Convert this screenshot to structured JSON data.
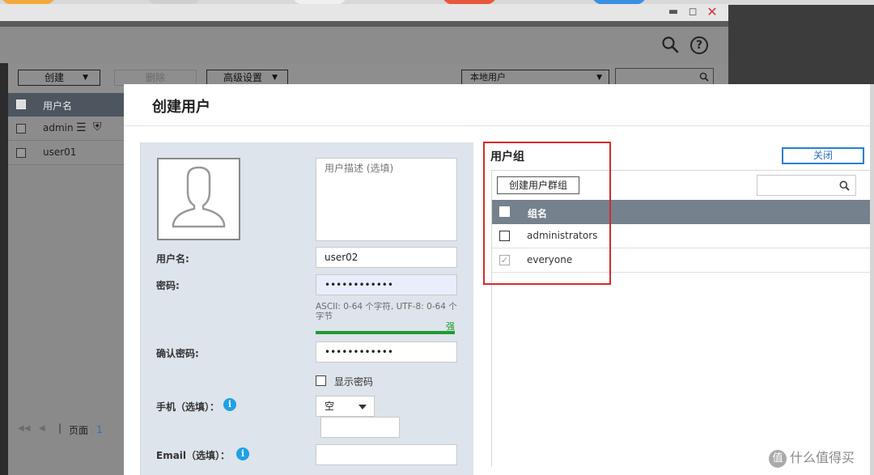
{
  "background_window": {
    "toolbar": {
      "create_label": "创建",
      "delete_label": "删除",
      "advanced_label": "高级设置",
      "scope_select": "本地用户"
    },
    "table": {
      "header": "用户名",
      "rows": [
        {
          "name": "admin"
        },
        {
          "name": "user01"
        }
      ]
    },
    "pager": {
      "page_label": "页面",
      "page_number": "1"
    }
  },
  "modal": {
    "title": "创建用户",
    "form": {
      "description_placeholder": "用户描述 (选填)",
      "username_label": "用户名:",
      "username_value": "user02",
      "password_label": "密码:",
      "password_value": "••••••••••••",
      "password_hint": "ASCII: 0-64 个字符, UTF-8: 0-64 个字节",
      "password_strength": "强",
      "confirm_label": "确认密码:",
      "confirm_value": "••••••••••••",
      "show_password_label": "显示密码",
      "phone_label": "手机（选填）：",
      "phone_select_value": "空",
      "email_label": "Email（选填）："
    },
    "groups": {
      "title": "用户组",
      "close_label": "关闭",
      "create_group_label": "创建用户群组",
      "column_header": "组名",
      "rows": [
        {
          "name": "administrators",
          "checked": false
        },
        {
          "name": "everyone",
          "checked": true
        }
      ]
    }
  },
  "watermark": {
    "badge": "值",
    "text": "什么值得买"
  },
  "colors": {
    "highlight": "#d82a2a",
    "strength": "#1e9b2e",
    "info_icon": "#1ea0e6",
    "close_border": "#2b7fd3",
    "table_header": "#75818c"
  }
}
